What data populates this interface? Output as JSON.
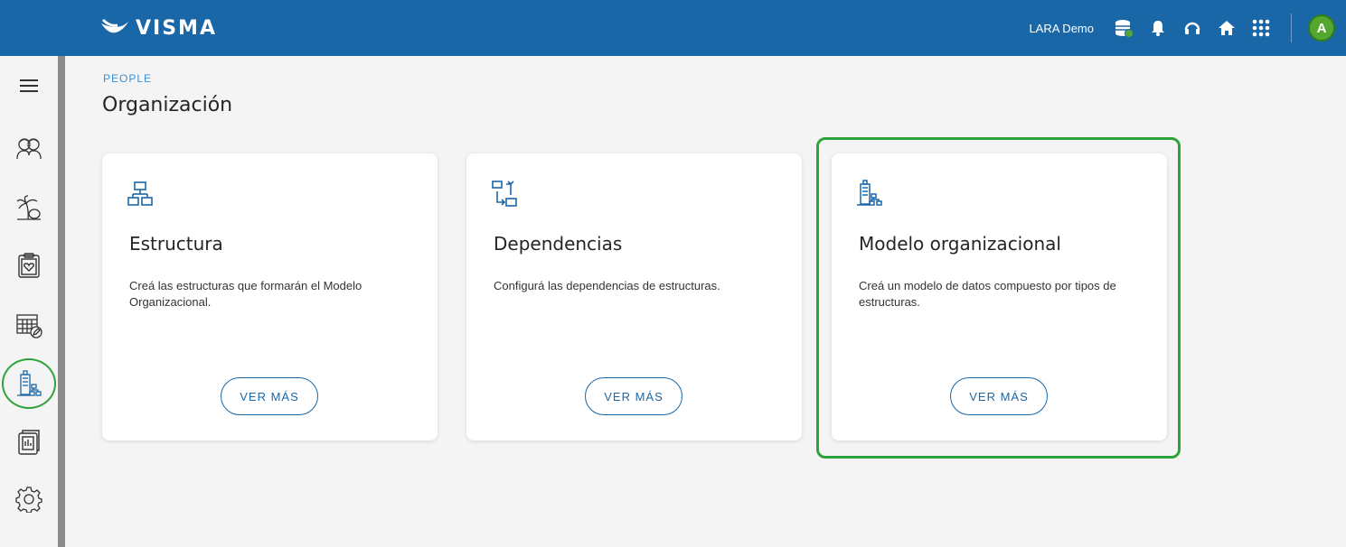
{
  "header": {
    "logo_text": "VISMA",
    "user_label": "LARA Demo",
    "avatar_initial": "A",
    "icons": [
      "database-icon",
      "bell-icon",
      "headset-icon",
      "home-icon",
      "apps-grid-icon"
    ]
  },
  "sidebar": {
    "items": [
      {
        "icon": "menu-icon"
      },
      {
        "icon": "people-icon"
      },
      {
        "icon": "vacation-icon"
      },
      {
        "icon": "clipboard-health-icon"
      },
      {
        "icon": "calendar-edit-icon"
      },
      {
        "icon": "organization-icon",
        "active": true
      },
      {
        "icon": "report-icon"
      },
      {
        "icon": "gear-icon"
      }
    ]
  },
  "page": {
    "breadcrumb": "PEOPLE",
    "title": "Organización"
  },
  "cards": [
    {
      "icon": "structure-icon",
      "title": "Estructura",
      "description": "Creá las estructuras que formarán el Modelo Organizacional.",
      "button": "VER MÁS"
    },
    {
      "icon": "dependencies-icon",
      "title": "Dependencias",
      "description": "Configurá las dependencias de estructuras.",
      "button": "VER MÁS"
    },
    {
      "icon": "org-model-icon",
      "title": "Modelo organizacional",
      "description": "Creá un modelo de datos compuesto por tipos de estructuras.",
      "button": "VER MÁS",
      "highlighted": true
    }
  ],
  "colors": {
    "header_bg": "#1a67a8",
    "accent": "#1a67a8",
    "highlight": "#2ea33a",
    "avatar": "#55a630"
  }
}
